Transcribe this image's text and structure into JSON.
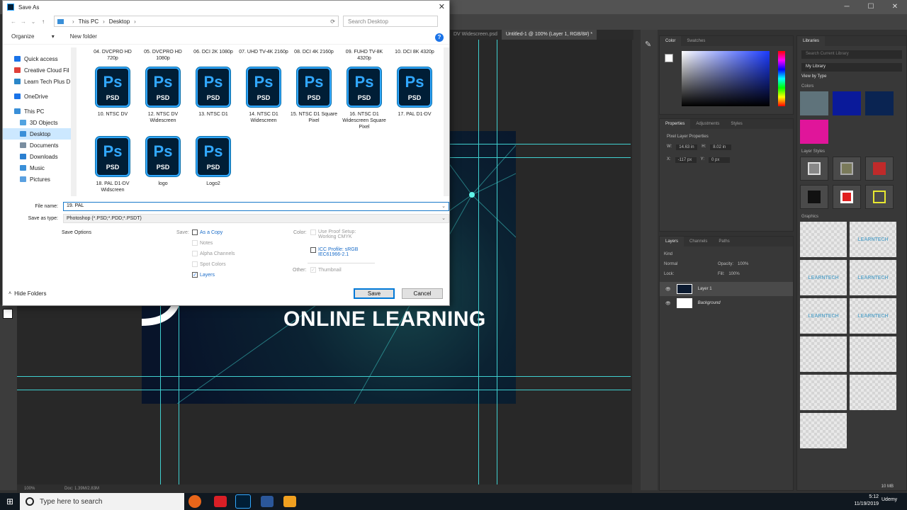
{
  "dialog": {
    "title": "Save As",
    "breadcrumb": [
      "This PC",
      "Desktop"
    ],
    "search_placeholder": "Search Desktop",
    "organize_label": "Organize",
    "new_folder_label": "New folder",
    "nav_items": [
      {
        "label": "Quick access",
        "icon_color": "#1a73e8"
      },
      {
        "label": "Creative Cloud Fil",
        "icon_color": "#e0403a"
      },
      {
        "label": "Learn Tech Plus D",
        "icon_color": "#2a86c8"
      },
      {
        "label": "OneDrive",
        "icon_color": "#1a73e8"
      },
      {
        "label": "This PC",
        "icon_color": "#3a8fd8"
      },
      {
        "label": "3D Objects",
        "icon_color": "#52a3e0"
      },
      {
        "label": "Desktop",
        "icon_color": "#3a8fd8"
      },
      {
        "label": "Documents",
        "icon_color": "#7a8ea0"
      },
      {
        "label": "Downloads",
        "icon_color": "#2a7fd0"
      },
      {
        "label": "Music",
        "icon_color": "#3a8fd8"
      },
      {
        "label": "Pictures",
        "icon_color": "#5aa0e0"
      }
    ],
    "top_row_files": [
      "04. DVCPRO HD 720p",
      "05. DVCPRO HD 1080p",
      "06. DCI 2K 1080p",
      "07. UHD TV-4K 2160p",
      "08. DCI 4K 2160p",
      "09. FUHD TV-8K 4320p",
      "10. DCI 8K 4320p"
    ],
    "files": [
      "10. NTSC DV",
      "12. NTSC DV Widescreen",
      "13. NTSC D1",
      "14. NTSC D1 Widescreen",
      "15. NTSC D1 Square Pixel",
      "16. NTSC D1 Widescreen Square Pixel",
      "17. PAL D1-DV",
      "18. PAL D1-DV Widscreen",
      "logo",
      "Logo2"
    ],
    "psd_icon_text": "Ps",
    "psd_icon_sub": "PSD",
    "file_name_label": "File name:",
    "file_name_value": "19. PAL",
    "save_as_type_label": "Save as type:",
    "save_as_type_value": "Photoshop (*.PSD;*.PDD;*.PSDT)",
    "save_options_label": "Save Options",
    "save_label": "Save:",
    "opt_as_copy": "As a Copy",
    "opt_notes": "Notes",
    "opt_alpha": "Alpha Channels",
    "opt_spot": "Spot Colors",
    "opt_layers": "Layers",
    "color_label": "Color:",
    "opt_proof": "Use Proof Setup: Working CMYK",
    "opt_icc": "ICC Profile: sRGB IEC61966-2.1",
    "other_label": "Other:",
    "opt_thumbnail": "Thumbnail",
    "save_button": "Save",
    "cancel_button": "Cancel",
    "hide_folders": "Hide Folders"
  },
  "photoshop": {
    "tabs": [
      "DV Widescreen.psd",
      "Untitled-1 @ 100% (Layer 1, RGB/8#) *"
    ],
    "doc_text_big": "EC",
    "doc_text_tagline": "ONLINE LEARNING",
    "status_zoom": "100%",
    "status_doc": "Doc: 1.39M/2.83M",
    "color_tabs": [
      "Color",
      "Swatches"
    ],
    "props_tabs": [
      "Properties",
      "Adjustments",
      "Styles"
    ],
    "props_title": "Pixel Layer Properties",
    "props_w": "14.63 in",
    "props_h": "8.02 in",
    "props_x": "-117 px",
    "props_y": "0 px",
    "layers_tabs": [
      "Layers",
      "Channels",
      "Paths"
    ],
    "layers_kind": "Kind",
    "layers_blend": "Normal",
    "layers_opacity_label": "Opacity:",
    "layers_opacity": "100%",
    "layers_lock_label": "Lock:",
    "layers_fill_label": "Fill:",
    "layers_fill": "100%",
    "layers": [
      "Layer 1",
      "Background"
    ],
    "libraries_title": "Libraries",
    "libraries_search": "Search Current Library",
    "libraries_current": "My Library",
    "libraries_view": "View by Type",
    "lib_colors_label": "Colors",
    "lib_colors": [
      "#5f737b",
      "#0a1a9a",
      "#0a2452",
      "#e0159a"
    ],
    "lib_styles_label": "Layer Styles",
    "lib_graphics_label": "Graphics",
    "lib_graphic_text": "LEARNTECH",
    "lib_size": "10 MB"
  },
  "taskbar": {
    "search_placeholder": "Type here to search",
    "time": "5:12",
    "date": "11/19/2019",
    "udemy": "Udemy"
  }
}
